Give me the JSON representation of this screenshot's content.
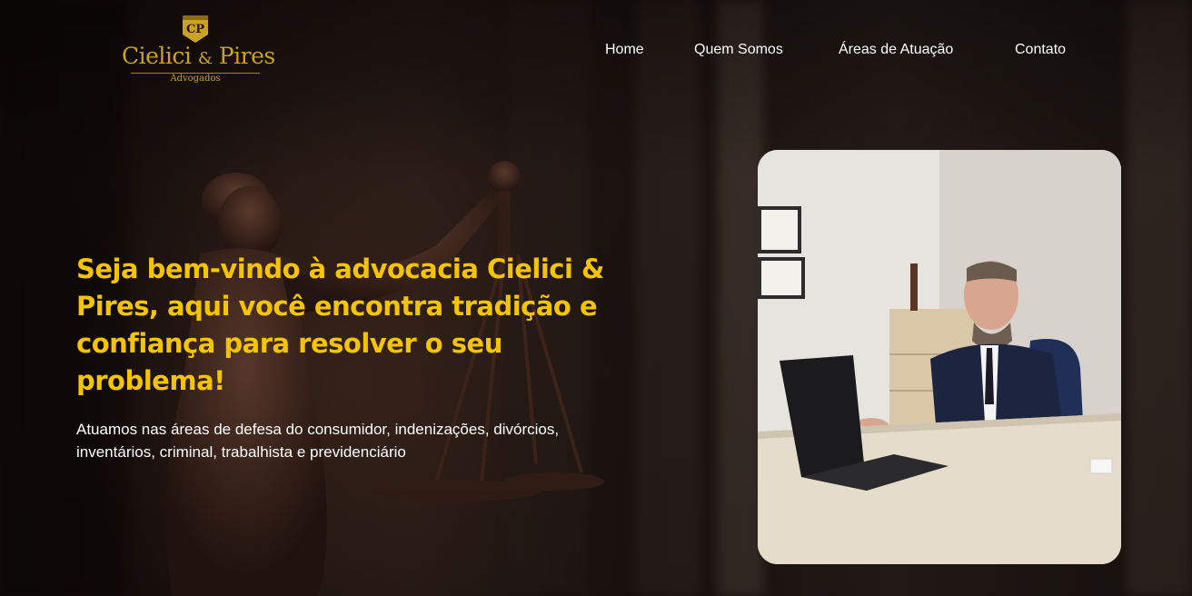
{
  "logo": {
    "monogram": "CP",
    "name": "Cielici",
    "ampersand": "&",
    "name2": "Pires",
    "subtitle": "Advogados",
    "color": "#c9a227"
  },
  "nav": {
    "items": [
      {
        "label": "Home"
      },
      {
        "label": "Quem Somos"
      },
      {
        "label": "Áreas de Atuação"
      },
      {
        "label": "Contato"
      }
    ]
  },
  "hero": {
    "headline": "Seja bem-vindo à advocacia Cielici & Pires, aqui você encontra tradição e confiança para resolver o seu problema!",
    "subtext": "Atuamos nas áreas de defesa do consumidor, indenizações, divórcios, inventários, criminal, trabalhista e previdenciário",
    "headline_color": "#f5c400"
  },
  "images": {
    "background": "statue-of-justice-background",
    "photo": "lawyer-at-laptop-photo"
  }
}
